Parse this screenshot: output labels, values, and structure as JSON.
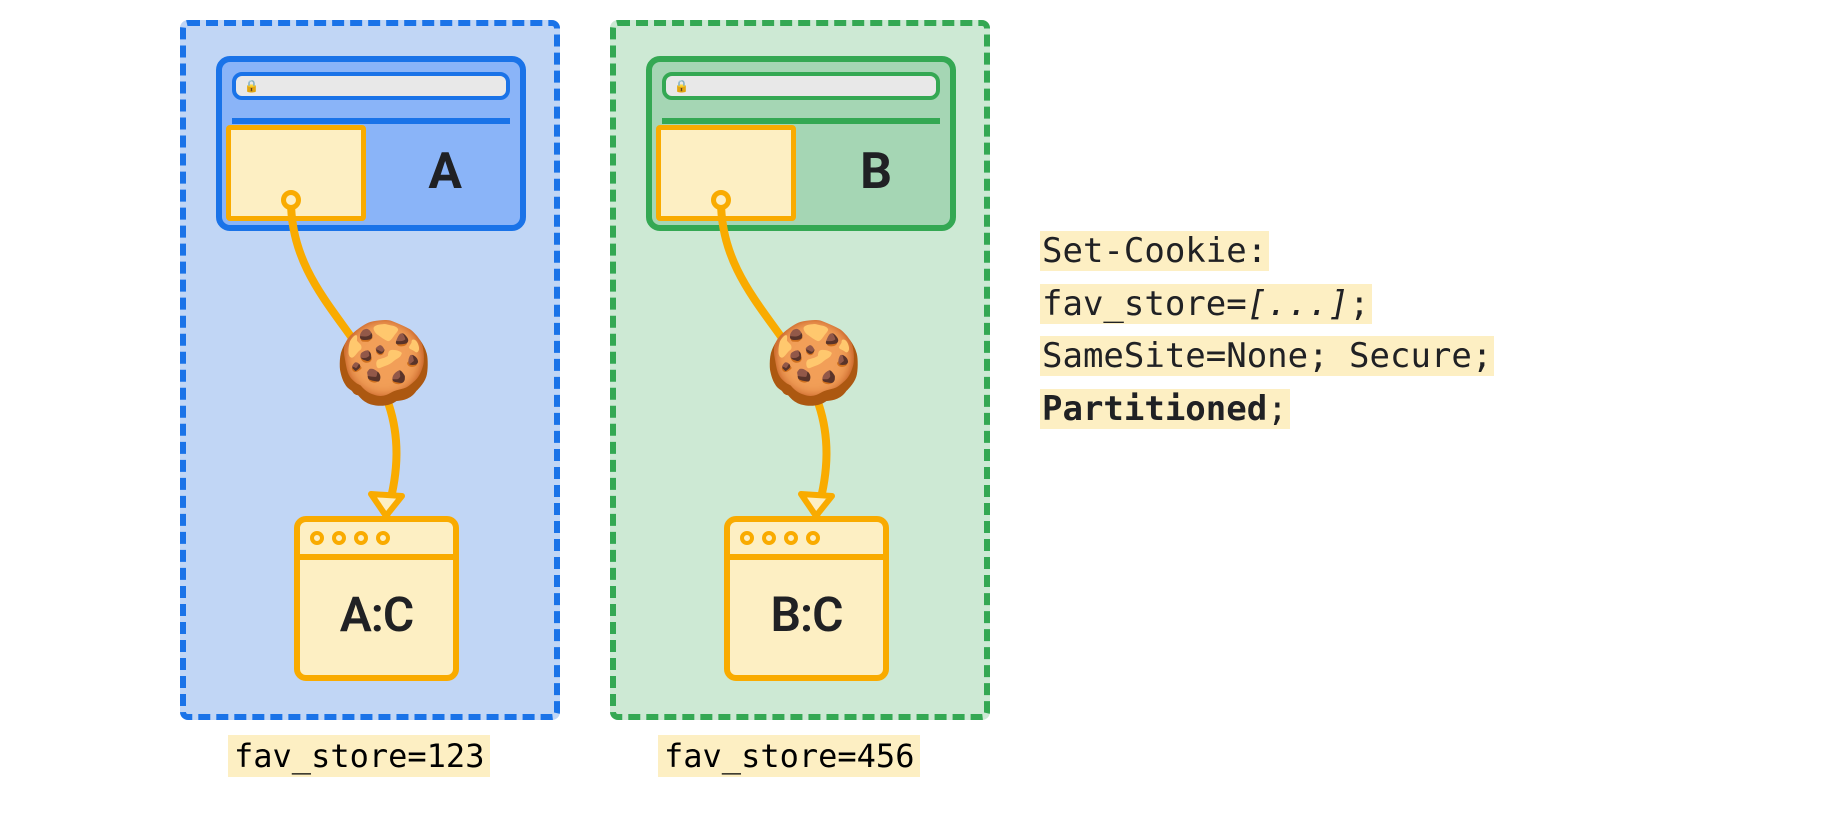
{
  "partitions": {
    "a": {
      "site": "A",
      "jar": "A:C",
      "caption": "fav_store=123"
    },
    "b": {
      "site": "B",
      "jar": "B:C",
      "caption": "fav_store=456"
    }
  },
  "icons": {
    "cookie": "🍪",
    "lock": "🔒"
  },
  "code": {
    "line1": "Set-Cookie:",
    "line2a": "fav_store=",
    "line2b": "[...]",
    "line2c": ";",
    "line3": "SameSite=None; Secure;",
    "line4a": "Partitioned",
    "line4b": ";"
  }
}
